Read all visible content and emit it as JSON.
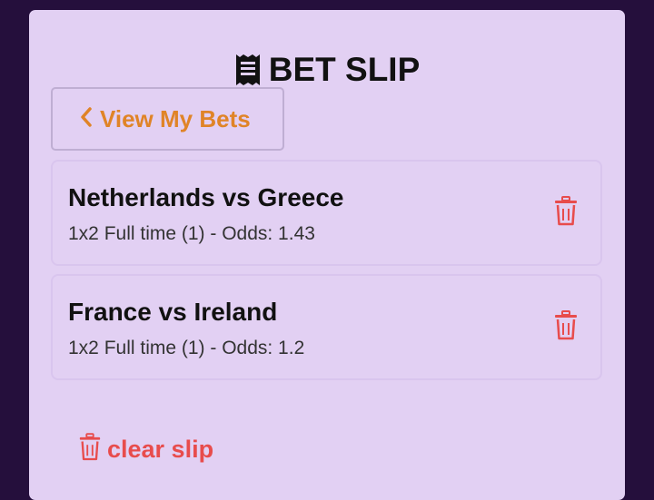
{
  "betslip": {
    "title": "BET SLIP",
    "title_icon": "receipt-icon",
    "view_bets_label": "View My Bets",
    "view_bets_icon": "chevron-left-icon",
    "bets": [
      {
        "match": "Netherlands vs Greece",
        "detail": "1x2 Full time (1) - Odds: 1.43"
      },
      {
        "match": "France vs Ireland",
        "detail": "1x2 Full time (1) - Odds: 1.2"
      }
    ],
    "remove_icon": "trash-icon",
    "clear_label": "clear slip"
  },
  "colors": {
    "background": "#250f3c",
    "panel": "#e2d0f3",
    "accent_orange": "#e08427",
    "danger_red": "#e84c4c"
  }
}
